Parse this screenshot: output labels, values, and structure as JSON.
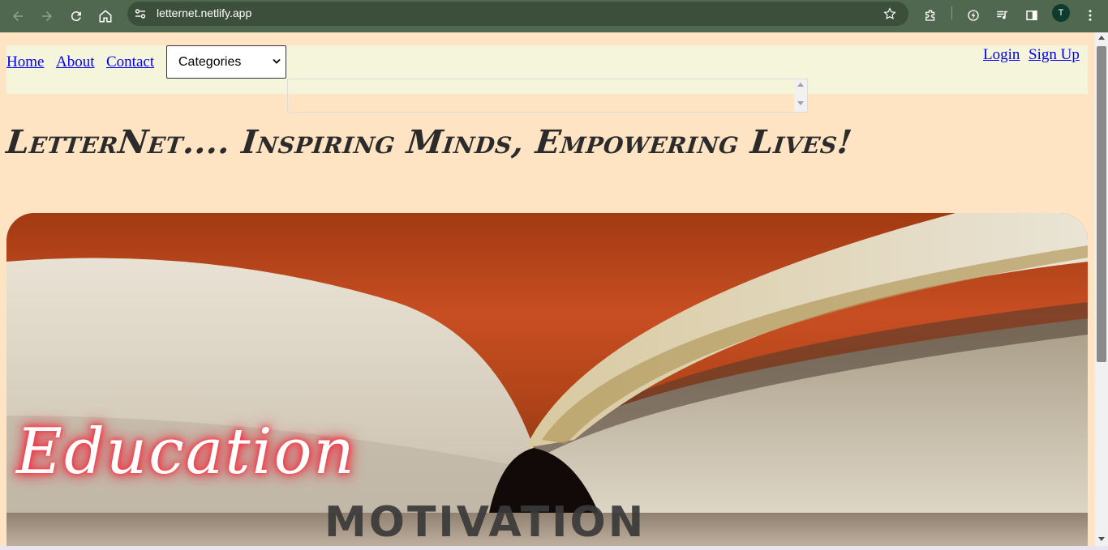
{
  "browser": {
    "url": "letternet.netlify.app",
    "profile_initial": "T",
    "colors": {
      "toolbar": "#506750",
      "omnibox": "#3b4f3b"
    },
    "icons": [
      "back-icon",
      "forward-icon",
      "reload-icon",
      "home-icon",
      "site-info-icon",
      "bookmark-star-icon",
      "extensions-icon",
      "performance-icon",
      "media-icon",
      "side-panel-icon",
      "menu-icon"
    ]
  },
  "nav": {
    "links": [
      "Home",
      "About",
      "Contact"
    ],
    "categories_selected": "Categories",
    "login": "Login",
    "signup": "Sign Up"
  },
  "hero": {
    "headline": "LetterNet.... Inspiring Minds, Empowering Lives!",
    "banner_script": "Education",
    "banner_word": "MOTIVATION"
  },
  "colors": {
    "page_background": "#ffe4c4",
    "navbar_background": "#f5f5dc",
    "link": "#0000ee",
    "headline": "#2b2b2b"
  }
}
